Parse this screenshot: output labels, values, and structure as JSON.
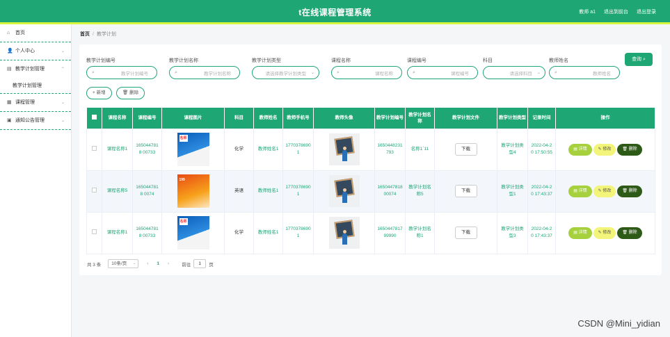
{
  "header": {
    "title": "t在线课程管理系统",
    "user": "教师 a1",
    "back_home": "退出到前台",
    "logout": "退出登录"
  },
  "sidebar": {
    "items": [
      {
        "label": "首页",
        "icon": "home-icon"
      },
      {
        "label": "个人中心",
        "icon": "user-icon"
      },
      {
        "label": "教学计划管理",
        "icon": "document-icon",
        "sub": [
          "教学计划管理"
        ]
      },
      {
        "label": "课程管理",
        "icon": "grid-icon"
      },
      {
        "label": "通知公告管理",
        "icon": "notice-icon"
      }
    ]
  },
  "breadcrumb": {
    "home": "首页",
    "current": "教学计划"
  },
  "filters": [
    {
      "label": "教学计划编号",
      "placeholder": "教学计划编号"
    },
    {
      "label": "教学计划名称",
      "placeholder": "教学计划名称"
    },
    {
      "label": "教学计划类型",
      "placeholder": "请选择教学计划类型"
    },
    {
      "label": "课程名称",
      "placeholder": "课程名称"
    },
    {
      "label": "课程编号",
      "placeholder": "课程编号"
    },
    {
      "label": "科目",
      "placeholder": "请选择科目"
    },
    {
      "label": "教师姓名",
      "placeholder": "教师姓名"
    }
  ],
  "buttons": {
    "search": "查询",
    "add": "新增",
    "delete": "删除"
  },
  "table": {
    "headers": [
      "课程名称",
      "课程编号",
      "课程图片",
      "科目",
      "教师姓名",
      "教师手机号",
      "教师头像",
      "教学计划编号",
      "教学计划名称",
      "教学计划文件",
      "教学计划类型",
      "记录时间",
      "操作"
    ],
    "rows": [
      {
        "course_name": "课程名称1",
        "course_no": "1650447818 00733",
        "cover": "blue",
        "cover_text": "名师",
        "subject": "化学",
        "teacher": "教师姓名1",
        "phone": "1770378690 1",
        "plan_no": "1650448231 793",
        "plan_name": "名称1`11",
        "file_btn": "下载",
        "plan_type": "教学计划类型4",
        "time": "2022-04-20 17:50:55"
      },
      {
        "course_name": "课程名称5",
        "course_no": "1650447818 0074",
        "cover": "orange",
        "cover_text": "199",
        "subject": "英语",
        "teacher": "教师姓名1",
        "phone": "1770378690 1",
        "plan_no": "1650447818 00074",
        "plan_name": "教学计划名称5",
        "file_btn": "下载",
        "plan_type": "教学计划类型1",
        "time": "2022-04-20 17:43:37"
      },
      {
        "course_name": "课程名称1",
        "course_no": "1650447818 00733",
        "cover": "blue",
        "cover_text": "名师",
        "subject": "化学",
        "teacher": "教师姓名1",
        "phone": "1770378690 1",
        "plan_no": "1650447817 99990",
        "plan_name": "教学计划名称1",
        "file_btn": "下载",
        "plan_type": "教学计划类型3",
        "time": "2022-04-20 17:43:37"
      }
    ],
    "actions": {
      "detail": "详情",
      "edit": "修改",
      "delete": "删除"
    }
  },
  "pagination": {
    "total": "共 3 条",
    "page_size": "10条/页",
    "current": "1",
    "goto": "前往",
    "goto_value": "1",
    "unit": "页"
  },
  "watermark": "CSDN @Mini_yidian",
  "colors": {
    "primary": "#1ea675",
    "accent_line": "#d6f53c",
    "detail": "#a6d13c",
    "edit": "#f2f57a",
    "delete": "#2e5a18"
  }
}
